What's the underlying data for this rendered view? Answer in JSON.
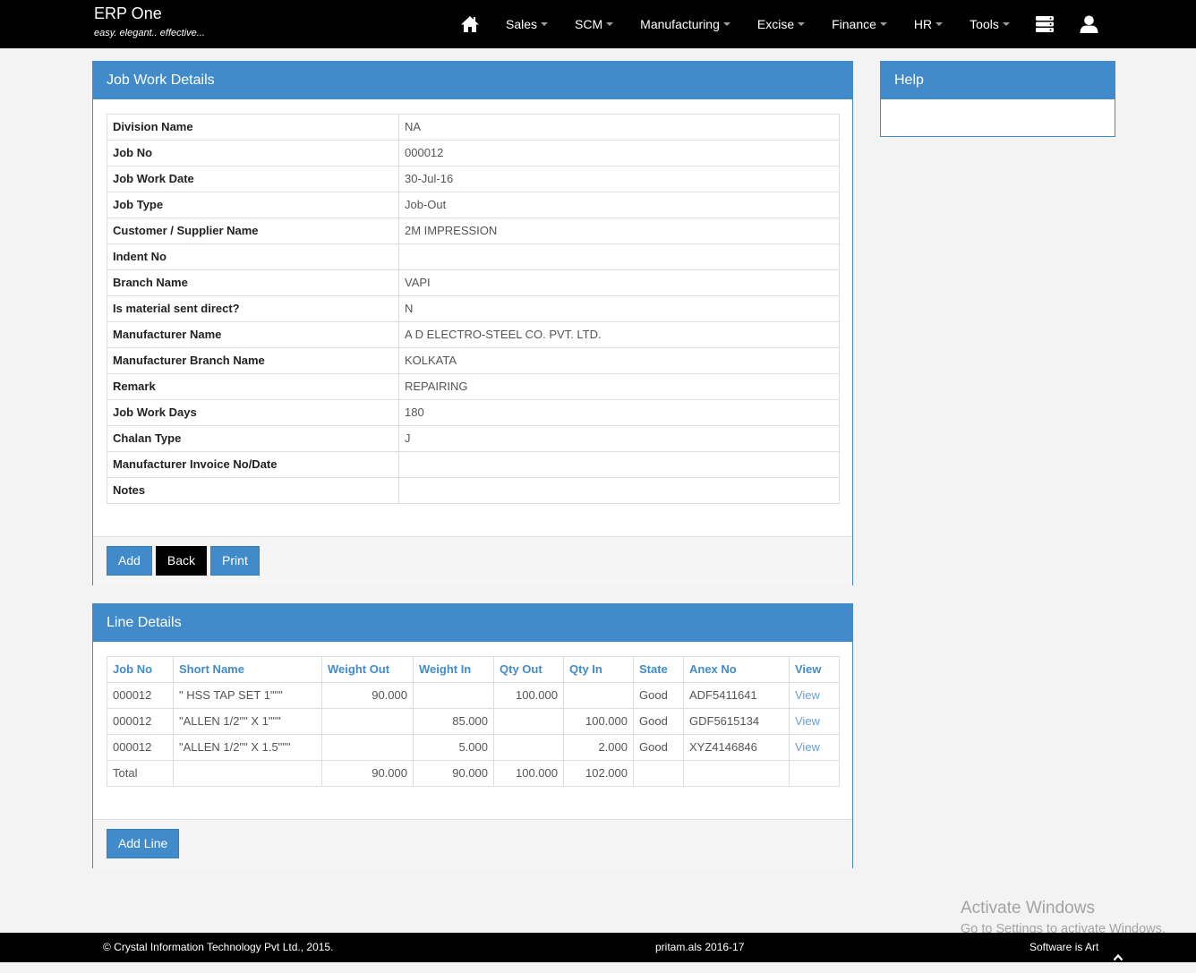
{
  "colors": {
    "primary": "#428bca",
    "navbar_bg": "#000000",
    "back_button_bg": "#000000",
    "page_bg": "#f3f3f3"
  },
  "brand": {
    "title": "ERP One",
    "tagline": "easy. elegant.. effective..."
  },
  "nav": {
    "home_icon": "home-icon",
    "items": [
      {
        "label": "Sales"
      },
      {
        "label": "SCM"
      },
      {
        "label": "Manufacturing"
      },
      {
        "label": "Excise"
      },
      {
        "label": "Finance"
      },
      {
        "label": "HR"
      },
      {
        "label": "Tools"
      }
    ],
    "server_icon": "server-icon",
    "user_icon": "user-icon"
  },
  "job_work_panel": {
    "title": "Job Work Details",
    "fields": [
      {
        "label": "Division Name",
        "value": "NA"
      },
      {
        "label": "Job No",
        "value": "000012"
      },
      {
        "label": "Job Work Date",
        "value": "30-Jul-16"
      },
      {
        "label": "Job Type",
        "value": "Job-Out"
      },
      {
        "label": "Customer / Supplier Name",
        "value": "2M IMPRESSION"
      },
      {
        "label": "Indent No"
      },
      {
        "label": "Branch Name",
        "value": "VAPI"
      },
      {
        "label": "Is material sent direct?",
        "value": "N"
      },
      {
        "label": "Manufacturer Name",
        "value": "A D ELECTRO-STEEL CO. PVT. LTD."
      },
      {
        "label": "Manufacturer Branch Name",
        "value": "KOLKATA"
      },
      {
        "label": "Remark",
        "value": "REPAIRING"
      },
      {
        "label": "Job Work Days",
        "value": "180"
      },
      {
        "label": "Chalan Type",
        "value": "J"
      },
      {
        "label": "Manufacturer Invoice No/Date"
      },
      {
        "label": "Notes"
      }
    ],
    "buttons": {
      "add": "Add",
      "back": "Back",
      "print": "Print"
    }
  },
  "line_details_panel": {
    "title": "Line Details",
    "columns": [
      "Job No",
      "Short Name",
      "Weight Out",
      "Weight In",
      "Qty Out",
      "Qty In",
      "State",
      "Anex No",
      "View"
    ],
    "rows": [
      {
        "job_no": "000012",
        "short_name": "\" HSS TAP SET 1\"\"\"",
        "weight_out": "90.000",
        "qty_out": "100.000",
        "state": "Good",
        "anex_no": "ADF5411641",
        "view": "View"
      },
      {
        "job_no": "000012",
        "short_name": "\"ALLEN 1/2\"\" X 1\"\"\"",
        "weight_in": "85.000",
        "qty_in": "100.000",
        "state": "Good",
        "anex_no": "GDF5615134",
        "view": "View"
      },
      {
        "job_no": "000012",
        "short_name": "\"ALLEN 1/2\"\" X 1.5\"\"\"",
        "weight_in": "5.000",
        "qty_in": "2.000",
        "state": "Good",
        "anex_no": "XYZ4146846",
        "view": "View"
      }
    ],
    "total": {
      "label": "Total",
      "weight_out": "90.000",
      "weight_in": "90.000",
      "qty_out": "100.000",
      "qty_in": "102.000"
    },
    "add_line_button": "Add Line"
  },
  "help_panel": {
    "title": "Help"
  },
  "footer": {
    "copyright": "© Crystal Information Technology Pvt Ltd., 2015.",
    "session": "pritam.als 2016-17",
    "slogan": "Software is Art",
    "scroll_top_icon": "chevron-up-icon"
  },
  "os_watermark": {
    "line1": "Activate Windows",
    "line2": "Go to Settings to activate Windows."
  }
}
